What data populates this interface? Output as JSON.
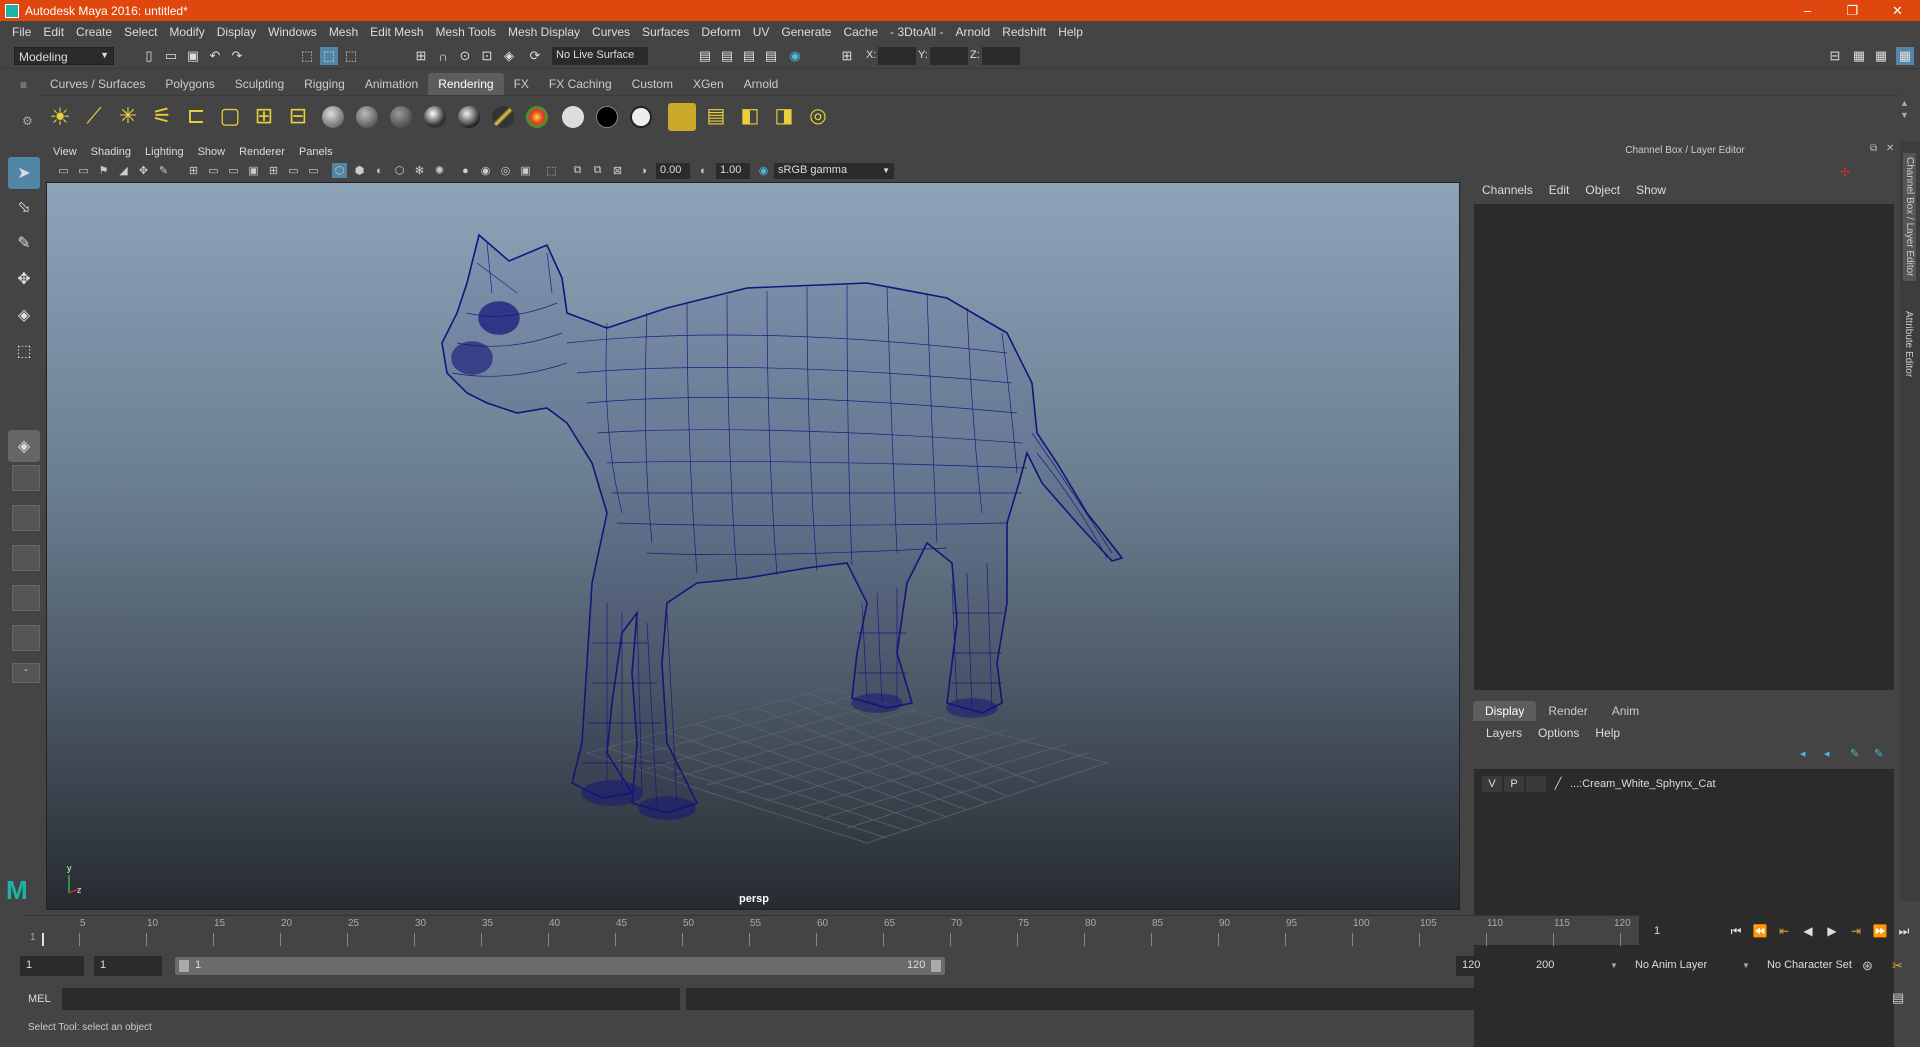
{
  "window": {
    "title": "Autodesk Maya 2016: untitled*",
    "minimize": "–",
    "restore": "❐",
    "close": "✕"
  },
  "menubar": [
    "File",
    "Edit",
    "Create",
    "Select",
    "Modify",
    "Display",
    "Windows",
    "Mesh",
    "Edit Mesh",
    "Mesh Tools",
    "Mesh Display",
    "Curves",
    "Surfaces",
    "Deform",
    "UV",
    "Generate",
    "Cache",
    "- 3DtoAll -",
    "Arnold",
    "Redshift",
    "Help"
  ],
  "statusline": {
    "mode": "Modeling",
    "live_surface": "No Live Surface",
    "x_label": "X:",
    "y_label": "Y:",
    "z_label": "Z:"
  },
  "shelf_tabs": [
    "Curves / Surfaces",
    "Polygons",
    "Sculpting",
    "Rigging",
    "Animation",
    "Rendering",
    "FX",
    "FX Caching",
    "Custom",
    "XGen",
    "Arnold"
  ],
  "shelf_active": "Rendering",
  "viewport": {
    "menu": [
      "View",
      "Shading",
      "Lighting",
      "Show",
      "Renderer",
      "Panels"
    ],
    "exposure": "0.00",
    "gamma": "1.00",
    "color_space": "sRGB gamma",
    "camera_label": "persp",
    "axis_y": "y",
    "axis_z": "z"
  },
  "channel_box": {
    "title": "Channel Box / Layer Editor",
    "menu": [
      "Channels",
      "Edit",
      "Object",
      "Show"
    ]
  },
  "layer_editor": {
    "tabs": [
      "Display",
      "Render",
      "Anim"
    ],
    "active_tab": "Display",
    "menu": [
      "Layers",
      "Options",
      "Help"
    ],
    "layers": [
      {
        "v": "V",
        "p": "P",
        "name": "...:Cream_White_Sphynx_Cat"
      }
    ]
  },
  "side_tabs": [
    "Channel Box / Layer Editor",
    "Attribute Editor"
  ],
  "timeline": {
    "ticks": [
      "5",
      "10",
      "15",
      "20",
      "25",
      "30",
      "35",
      "40",
      "45",
      "50",
      "55",
      "60",
      "65",
      "70",
      "75",
      "80",
      "85",
      "90",
      "95",
      "100",
      "105",
      "110",
      "115",
      "120"
    ],
    "start_label": "1",
    "current_frame": "1"
  },
  "range": {
    "start": "1",
    "playback_start": "1",
    "slider_start": "1",
    "slider_end": "120",
    "playback_end": "120",
    "end": "200",
    "anim_layer": "No Anim Layer",
    "character_set": "No Character Set"
  },
  "mel": {
    "label": "MEL"
  },
  "help_line": "Select Tool: select an object"
}
